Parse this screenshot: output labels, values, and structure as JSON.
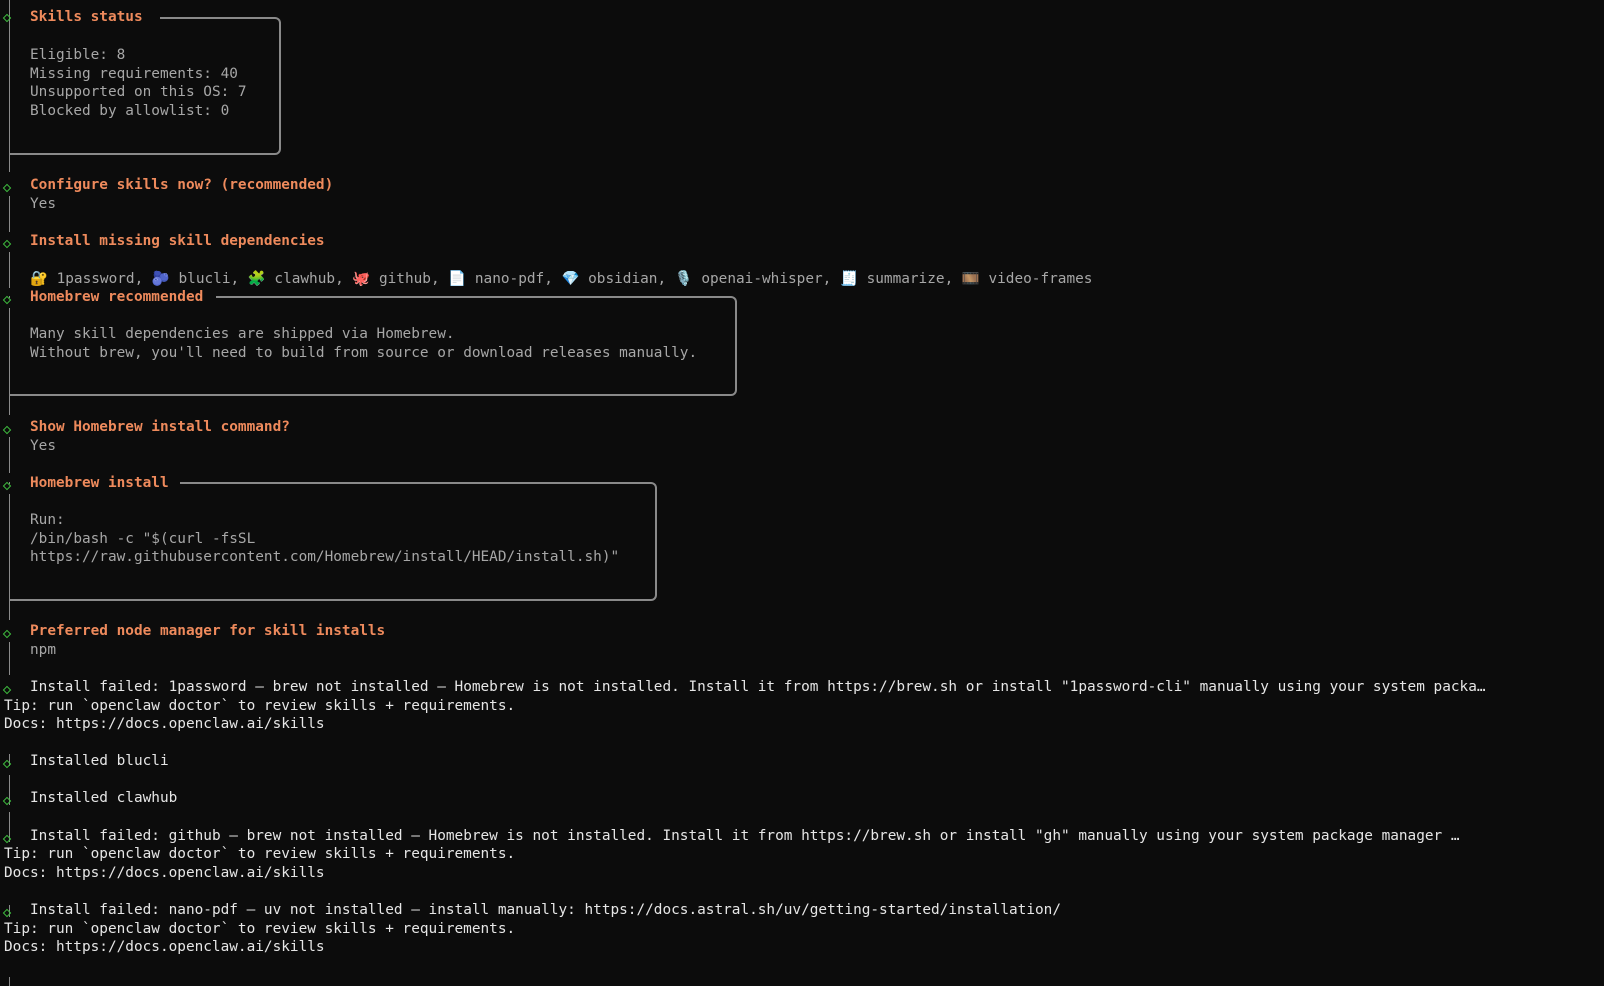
{
  "skills_status": {
    "title": "Skills status",
    "lines": [
      "Eligible: 8",
      "Missing requirements: 40",
      "Unsupported on this OS: 7",
      "Blocked by allowlist: 0"
    ]
  },
  "configure": {
    "question": "Configure skills now? (recommended)",
    "answer": "Yes"
  },
  "install_missing": {
    "title": "Install missing skill dependencies",
    "items": [
      {
        "icon": "🔐",
        "name": "1password"
      },
      {
        "icon": "🫐",
        "name": "blucli"
      },
      {
        "icon": "🧩",
        "name": "clawhub"
      },
      {
        "icon": "🐙",
        "name": "github"
      },
      {
        "icon": "📄",
        "name": "nano-pdf"
      },
      {
        "icon": "💎",
        "name": "obsidian"
      },
      {
        "icon": "🎙️",
        "name": "openai-whisper"
      },
      {
        "icon": "🧾",
        "name": "summarize"
      },
      {
        "icon": "🎞️",
        "name": "video-frames"
      }
    ]
  },
  "homebrew_recommended": {
    "title": "Homebrew recommended",
    "lines": [
      "Many skill dependencies are shipped via Homebrew.",
      "Without brew, you'll need to build from source or download releases manually."
    ]
  },
  "show_install": {
    "question": "Show Homebrew install command?",
    "answer": "Yes"
  },
  "homebrew_install": {
    "title": "Homebrew install",
    "lines": [
      "Run:",
      "/bin/bash -c \"$(curl -fsSL",
      "https://raw.githubusercontent.com/Homebrew/install/HEAD/install.sh)\""
    ]
  },
  "node_manager": {
    "question": "Preferred node manager for skill installs",
    "answer": "npm"
  },
  "log": {
    "fail_1password": "Install failed: 1password — brew not installed — Homebrew is not installed. Install it from https://brew.sh or install \"1password-cli\" manually using your system packa…",
    "tip1": "Tip: run `openclaw doctor` to review skills + requirements.",
    "docs1": "Docs: https://docs.openclaw.ai/skills",
    "installed_blucli": "Installed blucli",
    "installed_clawhub": "Installed clawhub",
    "fail_github": "Install failed: github — brew not installed — Homebrew is not installed. Install it from https://brew.sh or install \"gh\" manually using your system package manager …",
    "tip2": "Tip: run `openclaw doctor` to review skills + requirements.",
    "docs2": "Docs: https://docs.openclaw.ai/skills",
    "fail_nanopdf": "Install failed: nano-pdf — uv not installed — install manually: https://docs.astral.sh/uv/getting-started/installation/",
    "tip3": "Tip: run `openclaw doctor` to review skills + requirements.",
    "docs3": "Docs: https://docs.openclaw.ai/skills"
  },
  "colors": {
    "background": "#0c0c0c",
    "title": "#ee8a5c",
    "diamond": "#3fbf3f",
    "dim": "#a7a7a7",
    "text": "#e6e6e6"
  }
}
